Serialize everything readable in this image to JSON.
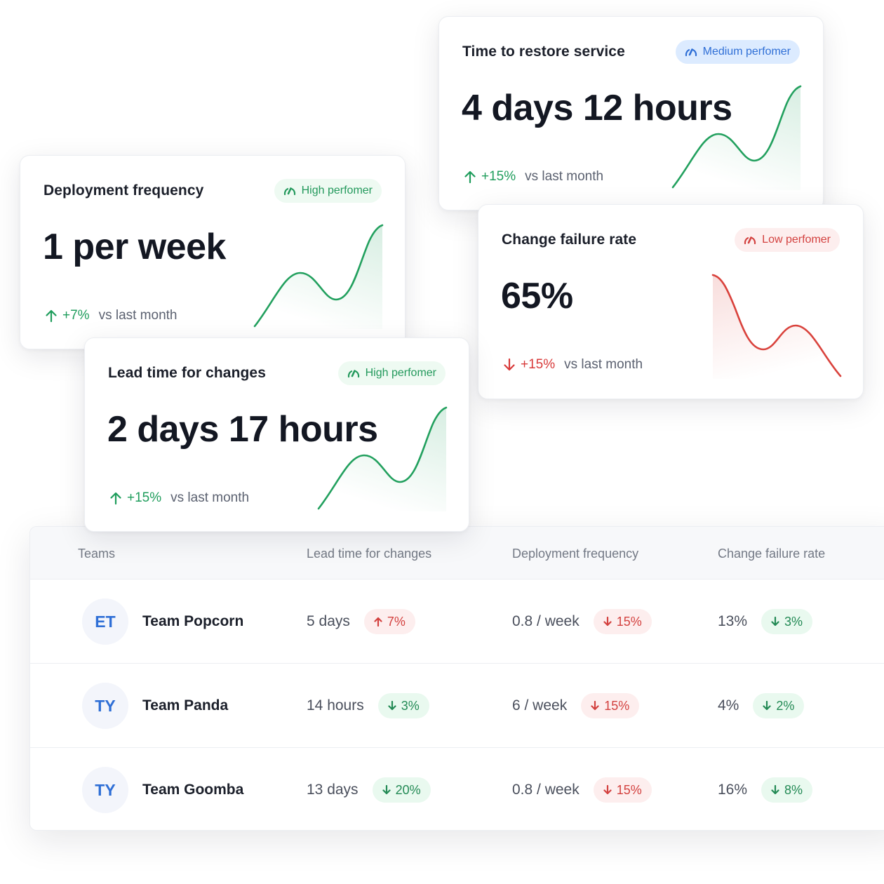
{
  "metric_cards": {
    "restore": {
      "title": "Time to restore service",
      "badge": "Medium perfomer",
      "badge_level": "medium",
      "value": "4 days 12 hours",
      "trend_direction": "up",
      "trend_pct": "+15%",
      "trend_label": "vs last month",
      "spark_color": "#22a05e"
    },
    "deploy": {
      "title": "Deployment frequency",
      "badge": "High perfomer",
      "badge_level": "high",
      "value": "1 per week",
      "trend_direction": "up",
      "trend_pct": "+7%",
      "trend_label": "vs last month",
      "spark_color": "#22a05e"
    },
    "failure": {
      "title": "Change failure rate",
      "badge": "Low perfomer",
      "badge_level": "low",
      "value": "65%",
      "trend_direction": "down",
      "trend_pct": "+15%",
      "trend_label": "vs last month",
      "spark_color": "#d9423c"
    },
    "lead": {
      "title": "Lead time for changes",
      "badge": "High perfomer",
      "badge_level": "high",
      "value": "2 days 17 hours",
      "trend_direction": "up",
      "trend_pct": "+15%",
      "trend_label": "vs last month",
      "spark_color": "#22a05e"
    }
  },
  "icons": {
    "badge": "speedometer-icon",
    "trend_up": "arrow-up-icon",
    "trend_down": "arrow-down-icon"
  },
  "colors": {
    "positive": "#1f9d5c",
    "negative": "#d83a3a",
    "medium_accent": "#2f6fd6"
  },
  "table": {
    "headers": [
      "Teams",
      "Lead time for changes",
      "Deployment frequency",
      "Change failure rate"
    ],
    "rows": [
      {
        "initials": "ET",
        "team": "Team Popcorn",
        "lead_time": "5 days",
        "lead_delta": "7%",
        "lead_dir": "up",
        "lead_status": "bad",
        "deploy_freq": "0.8 / week",
        "deploy_delta": "15%",
        "deploy_dir": "down",
        "deploy_status": "bad",
        "failure_rate": "13%",
        "failure_delta": "3%",
        "failure_dir": "down",
        "failure_status": "good"
      },
      {
        "initials": "TY",
        "team": "Team Panda",
        "lead_time": "14 hours",
        "lead_delta": "3%",
        "lead_dir": "down",
        "lead_status": "good",
        "deploy_freq": "6 / week",
        "deploy_delta": "15%",
        "deploy_dir": "down",
        "deploy_status": "bad",
        "failure_rate": "4%",
        "failure_delta": "2%",
        "failure_dir": "down",
        "failure_status": "good"
      },
      {
        "initials": "TY",
        "team": "Team Goomba",
        "lead_time": "13 days",
        "lead_delta": "20%",
        "lead_dir": "down",
        "lead_status": "good",
        "deploy_freq": "0.8 / week",
        "deploy_delta": "15%",
        "deploy_dir": "down",
        "deploy_status": "bad",
        "failure_rate": "16%",
        "failure_delta": "8%",
        "failure_dir": "down",
        "failure_status": "good"
      }
    ]
  }
}
